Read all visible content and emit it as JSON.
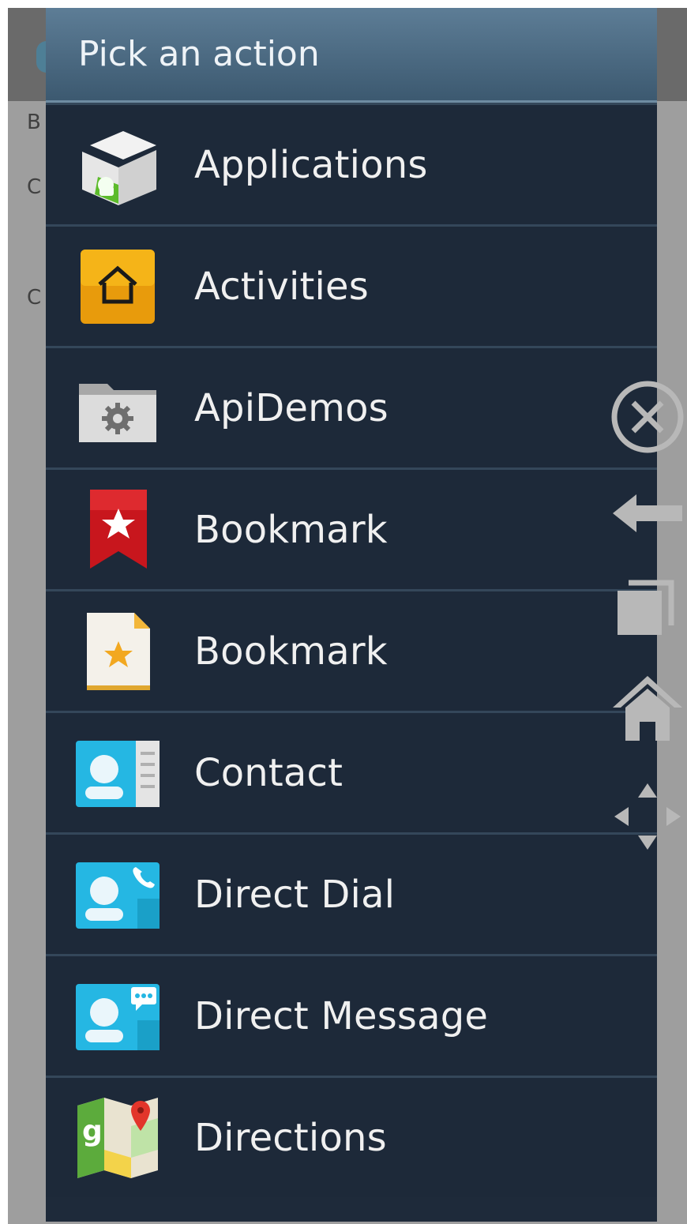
{
  "background": {
    "side_letters": [
      "B",
      "C",
      "C"
    ]
  },
  "dialog": {
    "title": "Pick an action",
    "items": [
      {
        "label": "Applications",
        "icon": "android-package-icon"
      },
      {
        "label": "Activities",
        "icon": "home-activity-icon"
      },
      {
        "label": "ApiDemos",
        "icon": "gear-folder-icon"
      },
      {
        "label": "Bookmark",
        "icon": "bookmark-ribbon-icon"
      },
      {
        "label": "Bookmark",
        "icon": "bookmark-page-icon"
      },
      {
        "label": "Contact",
        "icon": "contact-card-icon"
      },
      {
        "label": "Direct Dial",
        "icon": "direct-dial-icon"
      },
      {
        "label": "Direct Message",
        "icon": "direct-message-icon"
      },
      {
        "label": "Directions",
        "icon": "maps-icon"
      }
    ]
  },
  "nav_overlay": {
    "buttons": [
      "close-icon",
      "back-icon",
      "recent-apps-icon",
      "home-icon",
      "dpad-icon"
    ]
  },
  "colors": {
    "dialog_background": "#1d2939",
    "header_gradient_top": "#5d7d96",
    "header_gradient_bottom": "#3c5970",
    "divider": "#34475a",
    "dimmed_background": "#9e9e9e"
  }
}
